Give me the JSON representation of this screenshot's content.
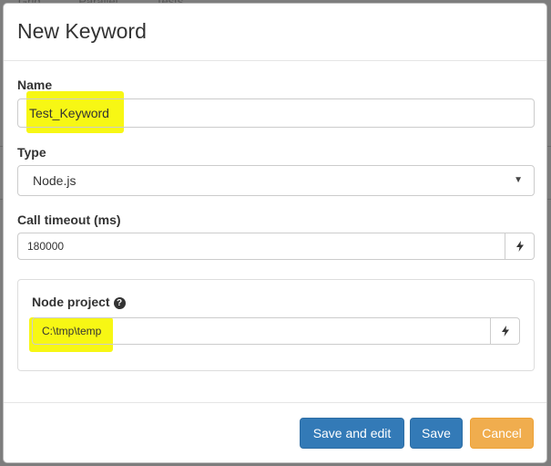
{
  "backdrop": {
    "tabs": [
      "Grid",
      "Parallel",
      "Tests"
    ]
  },
  "dialog": {
    "title": "New Keyword",
    "name": {
      "label": "Name",
      "value": "Test_Keyword"
    },
    "type": {
      "label": "Type",
      "selected": "Node.js"
    },
    "timeout": {
      "label": "Call timeout (ms)",
      "value": "180000"
    },
    "node_project": {
      "label": "Node project",
      "value": "C:\\tmp\\temp"
    },
    "buttons": {
      "save_and_edit": "Save and edit",
      "save": "Save",
      "cancel": "Cancel"
    }
  },
  "colors": {
    "primary": "#337ab7",
    "warning": "#f0ad4e",
    "highlight": "#f6f600"
  },
  "icons": {
    "dynamic_toggle": "lightning-bolt-icon",
    "help": "question-circle-icon",
    "select": "caret-down-icon"
  }
}
